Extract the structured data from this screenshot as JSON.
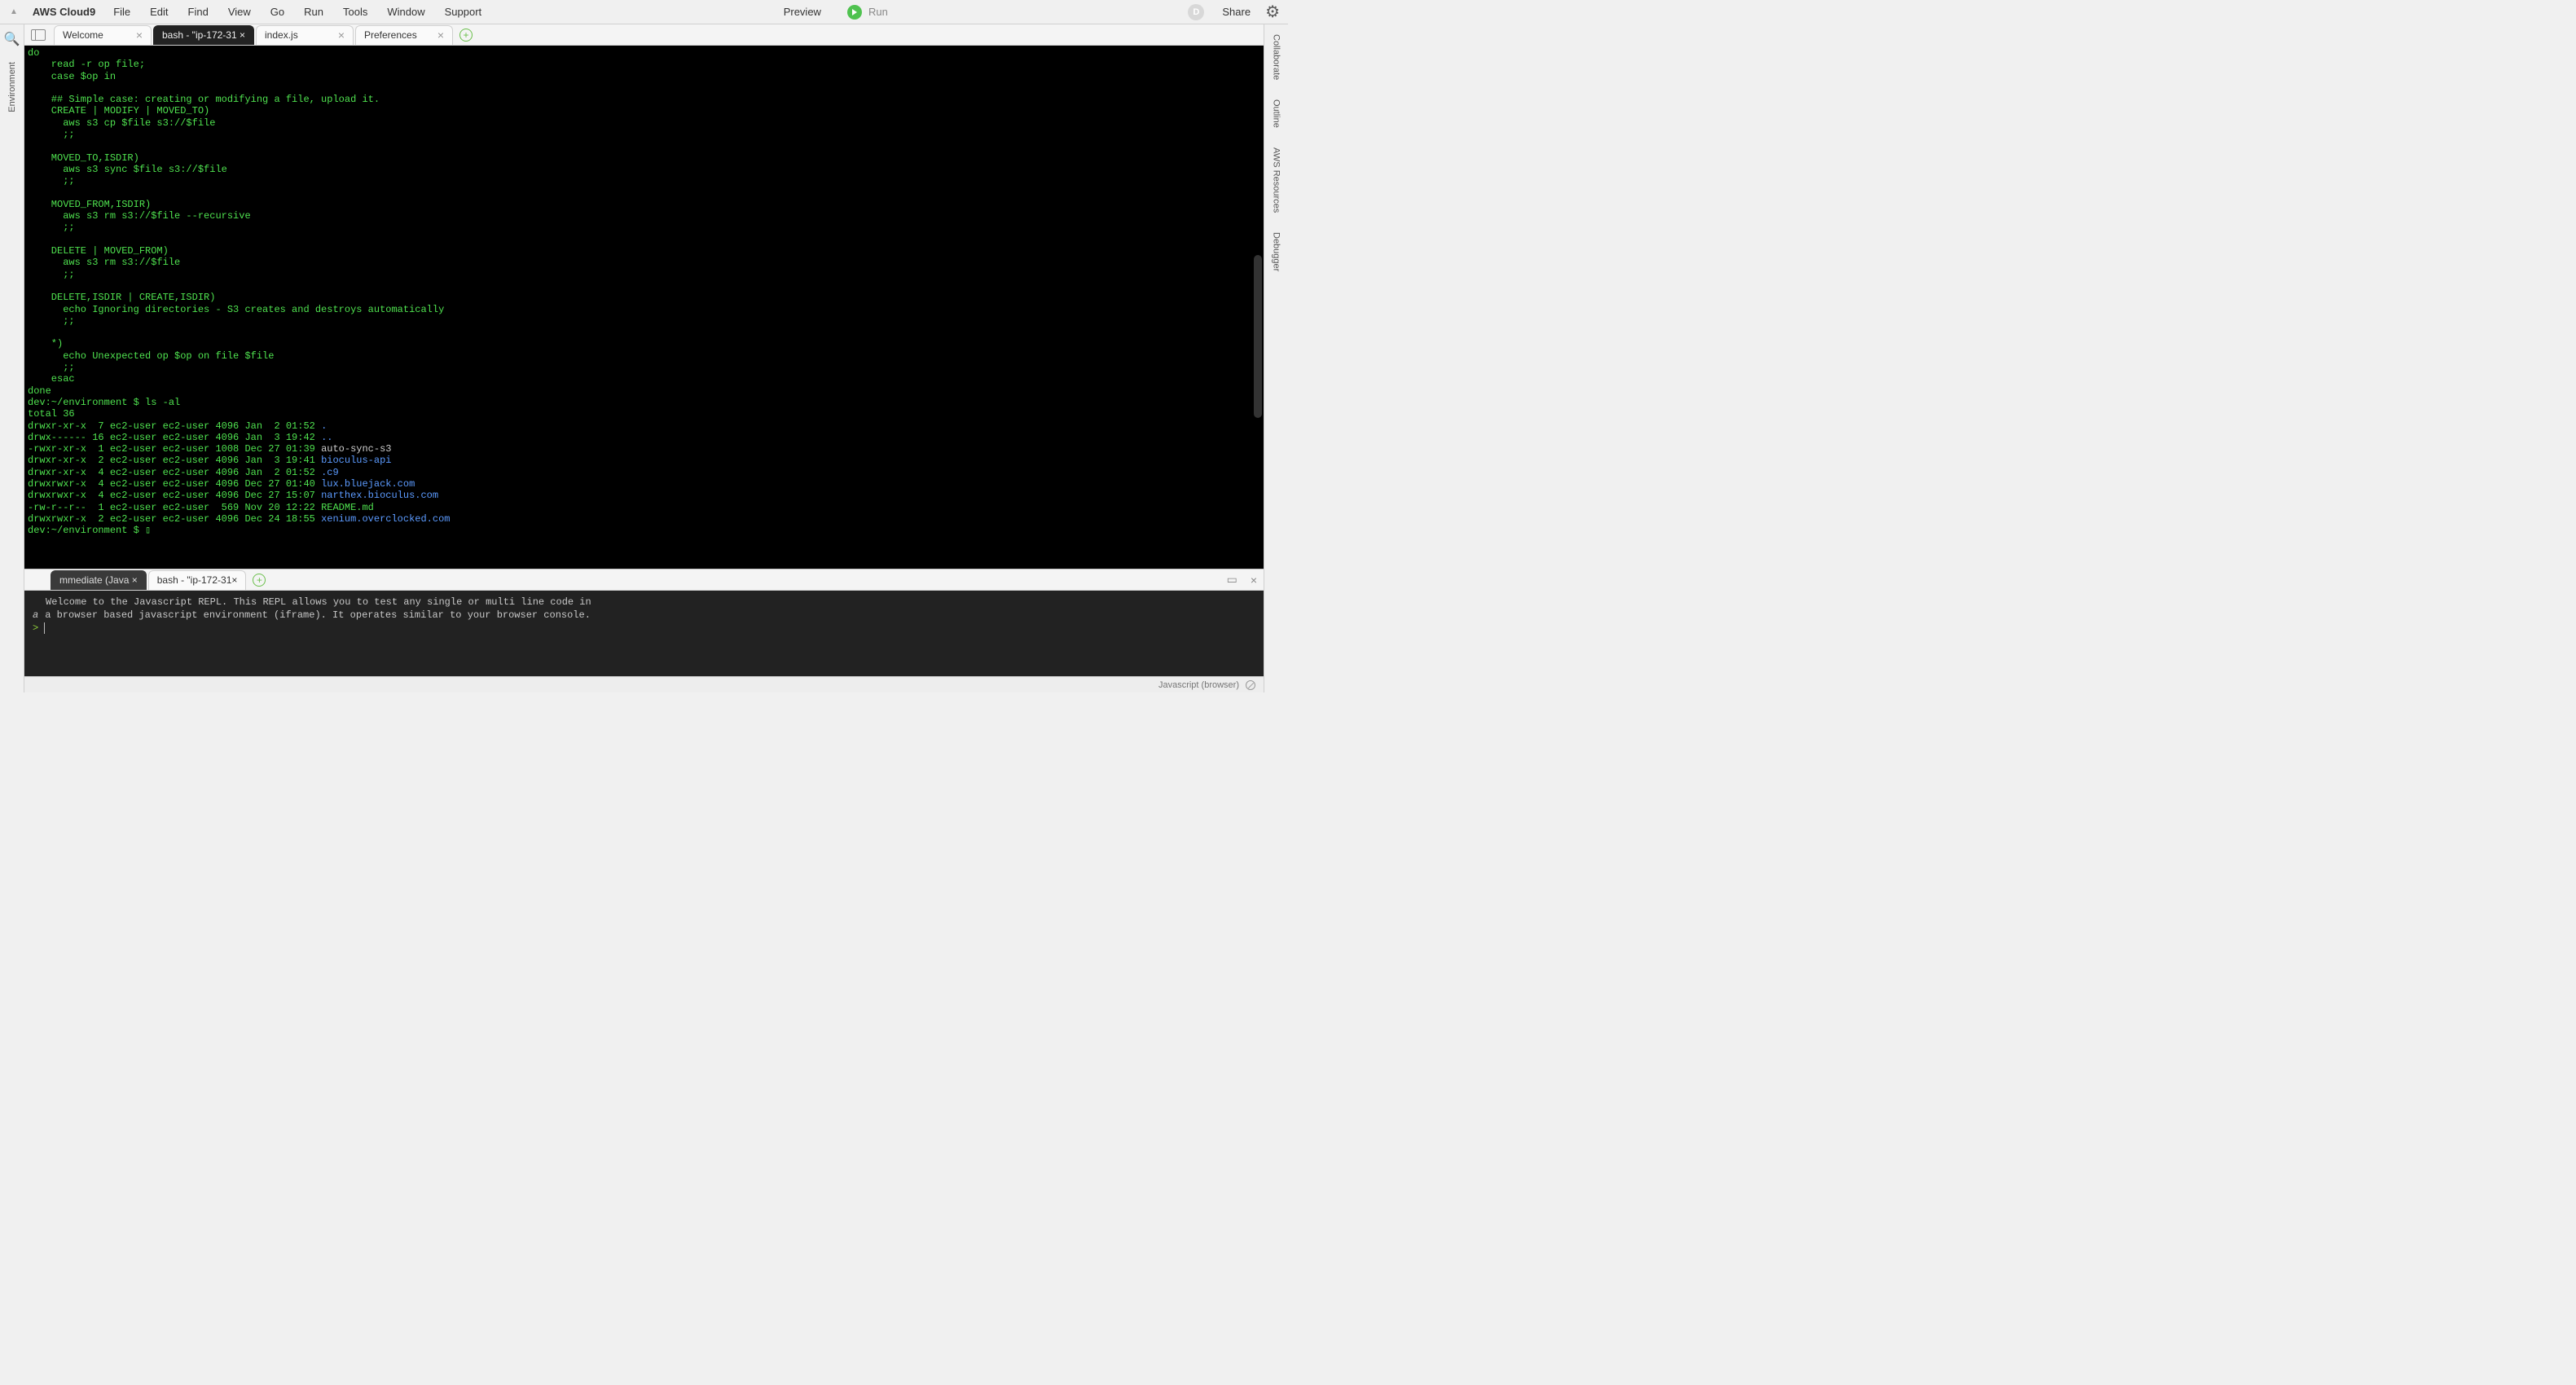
{
  "menubar": {
    "app_title": "AWS Cloud9",
    "items": [
      "File",
      "Edit",
      "Find",
      "View",
      "Go",
      "Run",
      "Tools",
      "Window",
      "Support"
    ],
    "preview": "Preview",
    "run": "Run",
    "avatar_letter": "D",
    "share": "Share"
  },
  "left_rail": {
    "label": "Environment"
  },
  "right_rail": {
    "items": [
      "Collaborate",
      "Outline",
      "AWS Resources",
      "Debugger"
    ]
  },
  "top_tabs": [
    {
      "label": "Welcome",
      "active": false
    },
    {
      "label": "bash - \"ip-172-31 ×",
      "active": true
    },
    {
      "label": "index.js",
      "active": false
    },
    {
      "label": "Preferences",
      "active": false
    }
  ],
  "terminal_lines": [
    {
      "segs": [
        {
          "t": "do",
          "c": "cy"
        }
      ]
    },
    {
      "segs": [
        {
          "t": "    read -r op file;",
          "c": "cy"
        }
      ]
    },
    {
      "segs": [
        {
          "t": "    case $op in",
          "c": "cy"
        }
      ]
    },
    {
      "segs": [
        {
          "t": " ",
          "c": "cy"
        }
      ]
    },
    {
      "segs": [
        {
          "t": "    ## Simple case: creating or modifying a file, upload it.",
          "c": "cy"
        }
      ]
    },
    {
      "segs": [
        {
          "t": "    CREATE | MODIFY | MOVED_TO)",
          "c": "cy"
        }
      ]
    },
    {
      "segs": [
        {
          "t": "      aws s3 cp $file s3://$file",
          "c": "cy"
        }
      ]
    },
    {
      "segs": [
        {
          "t": "      ;;",
          "c": "cy"
        }
      ]
    },
    {
      "segs": [
        {
          "t": " ",
          "c": "cy"
        }
      ]
    },
    {
      "segs": [
        {
          "t": "    MOVED_TO,ISDIR)",
          "c": "cy"
        }
      ]
    },
    {
      "segs": [
        {
          "t": "      aws s3 sync $file s3://$file",
          "c": "cy"
        }
      ]
    },
    {
      "segs": [
        {
          "t": "      ;;",
          "c": "cy"
        }
      ]
    },
    {
      "segs": [
        {
          "t": " ",
          "c": "cy"
        }
      ]
    },
    {
      "segs": [
        {
          "t": "    MOVED_FROM,ISDIR)",
          "c": "cy"
        }
      ]
    },
    {
      "segs": [
        {
          "t": "      aws s3 rm s3://$file --recursive",
          "c": "cy"
        }
      ]
    },
    {
      "segs": [
        {
          "t": "      ;;",
          "c": "cy"
        }
      ]
    },
    {
      "segs": [
        {
          "t": " ",
          "c": "cy"
        }
      ]
    },
    {
      "segs": [
        {
          "t": "    DELETE | MOVED_FROM)",
          "c": "cy"
        }
      ]
    },
    {
      "segs": [
        {
          "t": "      aws s3 rm s3://$file",
          "c": "cy"
        }
      ]
    },
    {
      "segs": [
        {
          "t": "      ;;",
          "c": "cy"
        }
      ]
    },
    {
      "segs": [
        {
          "t": " ",
          "c": "cy"
        }
      ]
    },
    {
      "segs": [
        {
          "t": "    DELETE,ISDIR | CREATE,ISDIR)",
          "c": "cy"
        }
      ]
    },
    {
      "segs": [
        {
          "t": "      echo Ignoring directories - S3 creates and destroys automatically",
          "c": "cy"
        }
      ]
    },
    {
      "segs": [
        {
          "t": "      ;;",
          "c": "cy"
        }
      ]
    },
    {
      "segs": [
        {
          "t": " ",
          "c": "cy"
        }
      ]
    },
    {
      "segs": [
        {
          "t": "    *)",
          "c": "cy"
        }
      ]
    },
    {
      "segs": [
        {
          "t": "      echo Unexpected op $op on file $file",
          "c": "cy"
        }
      ]
    },
    {
      "segs": [
        {
          "t": "      ;;",
          "c": "cy"
        }
      ]
    },
    {
      "segs": [
        {
          "t": "    esac",
          "c": "cy"
        }
      ]
    },
    {
      "segs": [
        {
          "t": "done",
          "c": "cy"
        }
      ]
    },
    {
      "segs": [
        {
          "t": "dev:~/environment $ ls -al",
          "c": "cy"
        }
      ]
    },
    {
      "segs": [
        {
          "t": "total 36",
          "c": "cy"
        }
      ]
    },
    {
      "segs": [
        {
          "t": "drwxr-xr-x  7 ec2-user ec2-user 4096 Jan  2 01:52 ",
          "c": "cy"
        },
        {
          "t": ".",
          "c": "cb"
        }
      ]
    },
    {
      "segs": [
        {
          "t": "drwx------ 16 ec2-user ec2-user 4096 Jan  3 19:42 ",
          "c": "cy"
        },
        {
          "t": "..",
          "c": "cb"
        }
      ]
    },
    {
      "segs": [
        {
          "t": "-rwxr-xr-x  1 ec2-user ec2-user 1008 Dec 27 01:39 ",
          "c": "cy"
        },
        {
          "t": "auto-sync-s3",
          "c": "cw"
        }
      ]
    },
    {
      "segs": [
        {
          "t": "drwxr-xr-x  2 ec2-user ec2-user 4096 Jan  3 19:41 ",
          "c": "cy"
        },
        {
          "t": "bioculus-api",
          "c": "cb"
        }
      ]
    },
    {
      "segs": [
        {
          "t": "drwxr-xr-x  4 ec2-user ec2-user 4096 Jan  2 01:52 ",
          "c": "cy"
        },
        {
          "t": ".c9",
          "c": "cb"
        }
      ]
    },
    {
      "segs": [
        {
          "t": "drwxrwxr-x  4 ec2-user ec2-user 4096 Dec 27 01:40 ",
          "c": "cy"
        },
        {
          "t": "lux.bluejack.com",
          "c": "cb"
        }
      ]
    },
    {
      "segs": [
        {
          "t": "drwxrwxr-x  4 ec2-user ec2-user 4096 Dec 27 15:07 ",
          "c": "cy"
        },
        {
          "t": "narthex.bioculus.com",
          "c": "cb"
        }
      ]
    },
    {
      "segs": [
        {
          "t": "-rw-r--r--  1 ec2-user ec2-user  569 Nov 20 12:22 ",
          "c": "cy"
        },
        {
          "t": "README.md",
          "c": "cy"
        }
      ]
    },
    {
      "segs": [
        {
          "t": "drwxrwxr-x  2 ec2-user ec2-user 4096 Dec 24 18:55 ",
          "c": "cy"
        },
        {
          "t": "xenium.overclocked.com",
          "c": "cb"
        }
      ]
    },
    {
      "segs": [
        {
          "t": "dev:~/environment $ ▯",
          "c": "cy"
        }
      ]
    }
  ],
  "bottom_tabs": [
    {
      "label": "mmediate (Java ×",
      "active": true
    },
    {
      "label": "bash - \"ip-172-31×",
      "active": false
    }
  ],
  "repl": {
    "line1": "Welcome to the Javascript REPL. This REPL allows you to test any single or multi line code in",
    "line2": "a browser based javascript environment (iframe). It operates similar to your browser console.",
    "prompt": ">"
  },
  "statusbar": {
    "label": "Javascript (browser)"
  }
}
